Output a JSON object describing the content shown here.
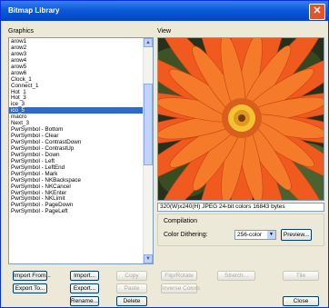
{
  "window": {
    "title": "Bitmap Library",
    "close_icon": "close-icon"
  },
  "labels": {
    "graphics": "Graphics",
    "view": "View"
  },
  "list": {
    "items": [
      "arow1",
      "arow2",
      "arow3",
      "arow4",
      "arow5",
      "arow6",
      "Clock_1",
      "Connect_1",
      "Hot_1",
      "Hot_3",
      "ice_3",
      "ico_5",
      "macro",
      "Next_3",
      "PwrSymbol - Bottom",
      "PwrSymbol - Clear",
      "PwrSymbol - ContrastDown",
      "PwrSymbol - ContrastUp",
      "PwrSymbol - Down",
      "PwrSymbol - Left",
      "PwrSymbol - LeftEnd",
      "PwrSymbol - Mark",
      "PwrSymbol - NKBackspace",
      "PwrSymbol - NKCancel",
      "PwrSymbol - NKEnter",
      "PwrSymbol - NKLimit",
      "PwrSymbol - PageDown",
      "PwrSymbol - PageLeft"
    ],
    "selected_index": 11
  },
  "image_info": "320(W)x240(H)  JPEG  24-bit colors  16843 bytes",
  "compilation": {
    "title": "Compilation",
    "dithering_label": "Color Dithering:",
    "dithering_value": "256-color",
    "preview_button": "Preview..."
  },
  "buttons": {
    "import_from": "Import From...",
    "import": "Import...",
    "copy": "Copy",
    "export_to": "Export To...",
    "export": "Export...",
    "paste": "Paste",
    "rename": "Rename...",
    "delete": "Delete",
    "flip_rotate": "Flip/Rotate",
    "stretch": "Stretch...",
    "tile": "Tile",
    "inverse_colors": "Inverse Colors",
    "close": "Close"
  },
  "colors": {
    "title_blue": "#0a5bd8",
    "selection": "#316ac5",
    "flower_orange": "#f05a1e"
  }
}
